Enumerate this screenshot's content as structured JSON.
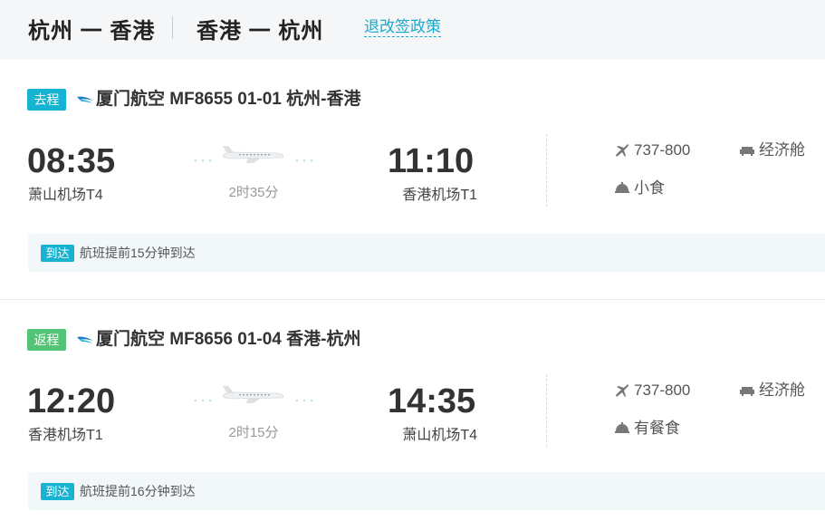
{
  "header": {
    "route_outbound": "杭州 一 香港",
    "route_return": "香港 一 杭州",
    "policy_link": "退改签政策"
  },
  "flights": [
    {
      "tag": "去程",
      "tag_color": "#17b3d2",
      "title": "厦门航空 MF8655  01-01 杭州-香港",
      "dep_time": "08:35",
      "dep_airport": "萧山机场T4",
      "arr_time": "11:10",
      "arr_airport": "香港机场T1",
      "duration": "2时35分",
      "aircraft": "737-800",
      "cabin": "经济舱",
      "meal": "小食",
      "notice_tag": "到达",
      "notice": "航班提前15分钟到达"
    },
    {
      "tag": "返程",
      "tag_color": "#52c476",
      "title": "厦门航空 MF8656  01-04 香港-杭州",
      "dep_time": "12:20",
      "dep_airport": "香港机场T1",
      "arr_time": "14:35",
      "arr_airport": "萧山机场T4",
      "duration": "2时15分",
      "aircraft": "737-800",
      "cabin": "经济舱",
      "meal": "有餐食",
      "notice_tag": "到达",
      "notice": "航班提前16分钟到达"
    }
  ],
  "icons": {
    "airline": "xiamen-airlines-logo-icon",
    "plane": "airplane-icon",
    "aircraft": "plane-icon",
    "cabin": "seat-icon",
    "meal": "meal-bell-icon"
  },
  "colors": {
    "accent": "#17b3d2",
    "return_tag": "#52c476",
    "link": "#19a9cf"
  }
}
